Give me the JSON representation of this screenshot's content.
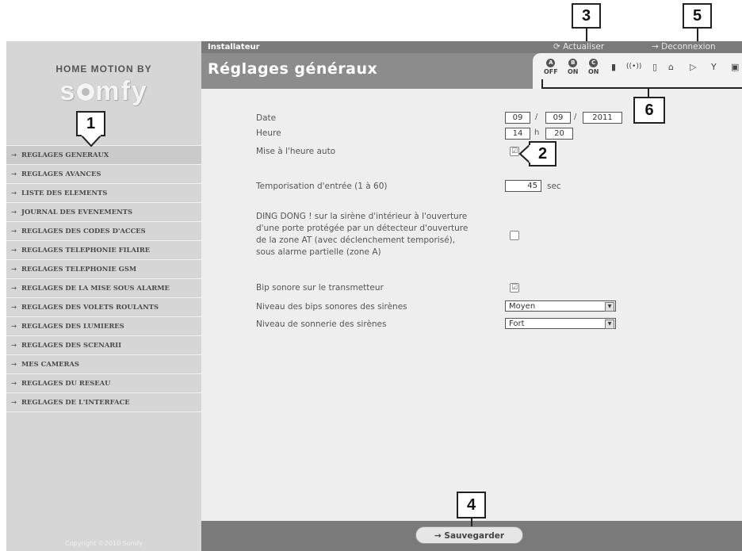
{
  "brand": {
    "line1": "HOME MOTION BY",
    "logo": "somfy"
  },
  "sidebar": {
    "items": [
      {
        "label": "REGLAGES GENERAUX"
      },
      {
        "label": "REGLAGES AVANCES"
      },
      {
        "label": "LISTE DES ELEMENTS"
      },
      {
        "label": "JOURNAL DES EVENEMENTS"
      },
      {
        "label": "REGLAGES DES CODES D'ACCES"
      },
      {
        "label": "REGLAGES TELEPHONIE FILAIRE"
      },
      {
        "label": "REGLAGES TELEPHONIE GSM"
      },
      {
        "label": "REGLAGES DE LA MISE SOUS ALARME"
      },
      {
        "label": "REGLAGES DES VOLETS ROULANTS"
      },
      {
        "label": "REGLAGES DES LUMIERES"
      },
      {
        "label": "REGLAGES DES SCENARII"
      },
      {
        "label": "MES CAMERAS"
      },
      {
        "label": "REGLAGES DU RESEAU"
      },
      {
        "label": "REGLAGES DE L'INTERFACE"
      }
    ],
    "arrow": "→",
    "copyright": "Copyright ©2010 Somfy"
  },
  "topbar": {
    "title": "Installateur",
    "refresh_label": "⟳ Actualiser",
    "logout_label": "→ Deconnexion"
  },
  "header": {
    "page_title": "Réglages généraux"
  },
  "status": {
    "zones": [
      {
        "letter": "A",
        "state": "OFF"
      },
      {
        "letter": "B",
        "state": "ON"
      },
      {
        "letter": "C",
        "state": "ON"
      }
    ],
    "icons": [
      "battery-icon",
      "signal-icon",
      "door-icon",
      "house-ok-icon",
      "sensor-icon",
      "antenna-icon",
      "card-icon"
    ]
  },
  "form": {
    "date_label": "Date",
    "date_day": "09",
    "date_month": "09",
    "date_year": "2011",
    "date_sep": "/",
    "heure_label": "Heure",
    "heure_h": "14",
    "heure_sep": "h",
    "heure_m": "20",
    "auto_time_label": "Mise à l'heure auto",
    "auto_time_checked": true,
    "entry_delay_label": "Temporisation d'entrée (1 à 60)",
    "entry_delay_value": "45",
    "entry_delay_unit": "sec",
    "dingdong_lines": [
      "DING DONG ! sur la sirène d'intérieur à l'ouverture",
      "d'une porte protégée par un détecteur d'ouverture",
      "de la zone AT (avec déclenchement temporisé),",
      "sous alarme partielle (zone A)"
    ],
    "dingdong_checked": false,
    "beep_label": "Bip sonore sur le transmetteur",
    "beep_checked": true,
    "siren_beep_label": "Niveau des bips sonores des sirènes",
    "siren_beep_value": "Moyen",
    "siren_ring_label": "Niveau de sonnerie des sirènes",
    "siren_ring_value": "Fort"
  },
  "footer": {
    "save_label": "→   Sauvegarder"
  },
  "callouts": [
    "1",
    "2",
    "3",
    "4",
    "5",
    "6"
  ],
  "check_glyph": "☑"
}
